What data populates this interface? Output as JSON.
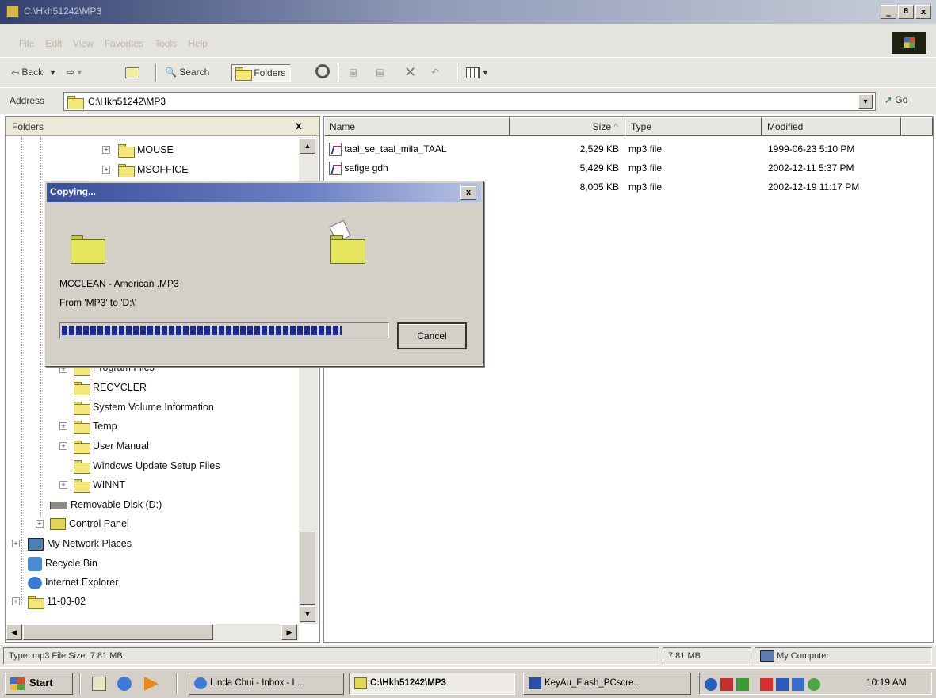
{
  "window": {
    "title": "C:\\Hkh51242\\MP3",
    "minimize_label": "_",
    "maximize_label": "8",
    "close_label": "x"
  },
  "menu": [
    "File",
    "Edit",
    "View",
    "Favorites",
    "Tools",
    "Help"
  ],
  "toolbar": {
    "back": "Back",
    "search": "Search",
    "folders": "Folders"
  },
  "address": {
    "label": "Address",
    "value": "C:\\Hkh51242\\MP3",
    "go": "Go"
  },
  "folders_pane": {
    "title": "Folders",
    "close": "x",
    "items": [
      {
        "label": "MOUSE"
      },
      {
        "label": "MSOFFICE"
      },
      {
        "label": "Program Files"
      },
      {
        "label": "RECYCLER"
      },
      {
        "label": "System Volume Information"
      },
      {
        "label": "Temp"
      },
      {
        "label": "User Manual"
      },
      {
        "label": "Windows Update Setup Files"
      },
      {
        "label": "WINNT"
      },
      {
        "label": "Removable Disk (D:)"
      },
      {
        "label": "Control Panel"
      },
      {
        "label": "My Network Places"
      },
      {
        "label": "Recycle Bin"
      },
      {
        "label": "Internet Explorer"
      },
      {
        "label": "11-03-02"
      }
    ]
  },
  "files_pane": {
    "columns": {
      "name": "Name",
      "size": "Size",
      "type": "Type",
      "modified": "Modified"
    },
    "rows": [
      {
        "name": "taal_se_taal_mila_TAAL",
        "size": "2,529 KB",
        "type": "mp3 file",
        "modified": "1999-06-23 5:10 PM"
      },
      {
        "name": "safige gdh",
        "size": "5,429 KB",
        "type": "mp3 file",
        "modified": "2002-12-11 5:37 PM"
      },
      {
        "name": "",
        "size": "8,005 KB",
        "type": "mp3 file",
        "modified": "2002-12-19 11:17 PM"
      }
    ]
  },
  "copy_dialog": {
    "title": "Copying...",
    "close": "x",
    "file": "MCCLEAN - American .MP3",
    "from_to": "From 'MP3' to 'D:\\'",
    "progress": 0.86,
    "cancel": "Cancel"
  },
  "statusbar": {
    "info": "Type: mp3 File Size: 7.81 MB",
    "size": "7.81 MB",
    "location": "My Computer"
  },
  "taskbar": {
    "start": "Start",
    "tasks": [
      {
        "label": "Linda Chui - Inbox - L...",
        "active": false
      },
      {
        "label": "C:\\Hkh51242\\MP3",
        "active": true
      },
      {
        "label": "KeyAu_Flash_PCscre...",
        "active": false
      }
    ],
    "clock": "10:19 AM"
  },
  "colors": {
    "title_gradient_start": "#33416e",
    "dialog_title": "#3a4f9a",
    "progress_block": "#1a2a8c",
    "folder_yellow": "#f3e77a",
    "chrome": "#d4d0c8"
  }
}
